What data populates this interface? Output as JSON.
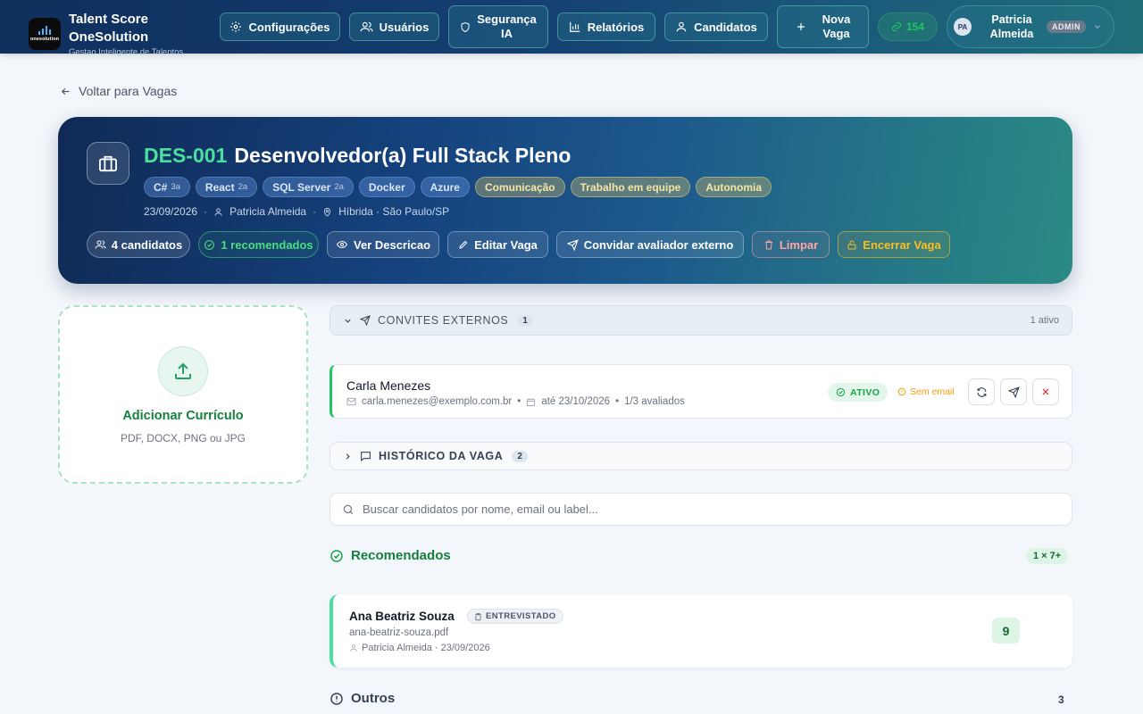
{
  "brand": {
    "logo_text": "onesolution",
    "title_line1": "Talent Score",
    "title_line2": "OneSolution",
    "subtitle": "Gestao Inteligente de Talentos"
  },
  "nav": {
    "items": [
      {
        "label": "Configurações",
        "icon": "gear-icon"
      },
      {
        "label": "Usuários",
        "icon": "users-icon"
      },
      {
        "label_line1": "Segurança",
        "label_line2": "IA",
        "icon": "shield-icon"
      },
      {
        "label": "Relatórios",
        "icon": "bar-chart-icon"
      },
      {
        "label": "Candidatos",
        "icon": "user-icon"
      },
      {
        "label_line1": "Nova",
        "label_line2": "Vaga",
        "icon": "plus-icon"
      }
    ],
    "credits": "154",
    "user": {
      "initials": "PA",
      "name_line1": "Patricia",
      "name_line2": "Almeida",
      "role": "ADMIN"
    }
  },
  "back": {
    "label": "Voltar para Vagas"
  },
  "job": {
    "code": "DES-001",
    "title": "Desenvolvedor(a) Full Stack Pleno",
    "tech_tags": [
      {
        "name": "C#",
        "level": "3a"
      },
      {
        "name": "React",
        "level": "2a"
      },
      {
        "name": "SQL Server",
        "level": "2a"
      },
      {
        "name": "Docker",
        "level": ""
      },
      {
        "name": "Azure",
        "level": ""
      }
    ],
    "soft_tags": [
      "Comunicação",
      "Trabalho em equipe",
      "Autonomia"
    ],
    "date": "23/09/2026",
    "owner": "Patricia Almeida",
    "location": "Híbrida · São Paulo/SP",
    "actions": {
      "candidates": "4 candidatos",
      "recommended": "1 recomendados",
      "view": "Ver Descricao",
      "edit": "Editar Vaga",
      "invite": "Convidar avaliador externo",
      "clear": "Limpar",
      "close": "Encerrar Vaga"
    }
  },
  "upload": {
    "title": "Adicionar Currículo",
    "formats": "PDF, DOCX, PNG ou JPG"
  },
  "convites": {
    "label": "CONVITES EXTERNOS",
    "count": "1",
    "status_summary": "1 ativo",
    "invite": {
      "name": "Carla Menezes",
      "email": "carla.menezes@exemplo.com.br",
      "until": "até 23/10/2026",
      "progress": "1/3 avaliados",
      "status": "ATIVO",
      "email_status": "Sem email"
    }
  },
  "historico": {
    "label": "HISTÓRICO DA VAGA",
    "count": "2"
  },
  "search": {
    "placeholder": "Buscar candidatos por nome, email ou label..."
  },
  "recomendados": {
    "title": "Recomendados",
    "badge": "1 × 7+",
    "candidate": {
      "name": "Ana Beatriz Souza",
      "status": "ENTREVISTADO",
      "file": "ana-beatriz-souza.pdf",
      "meta": "Patricia Almeida · 23/09/2026",
      "score": "9"
    }
  },
  "outros": {
    "title": "Outros",
    "count": "3"
  },
  "colors": {
    "accent_green": "#16a34a",
    "hero_code": "#4ade9f",
    "amber": "#f59e0b",
    "danger": "#dc2626"
  }
}
